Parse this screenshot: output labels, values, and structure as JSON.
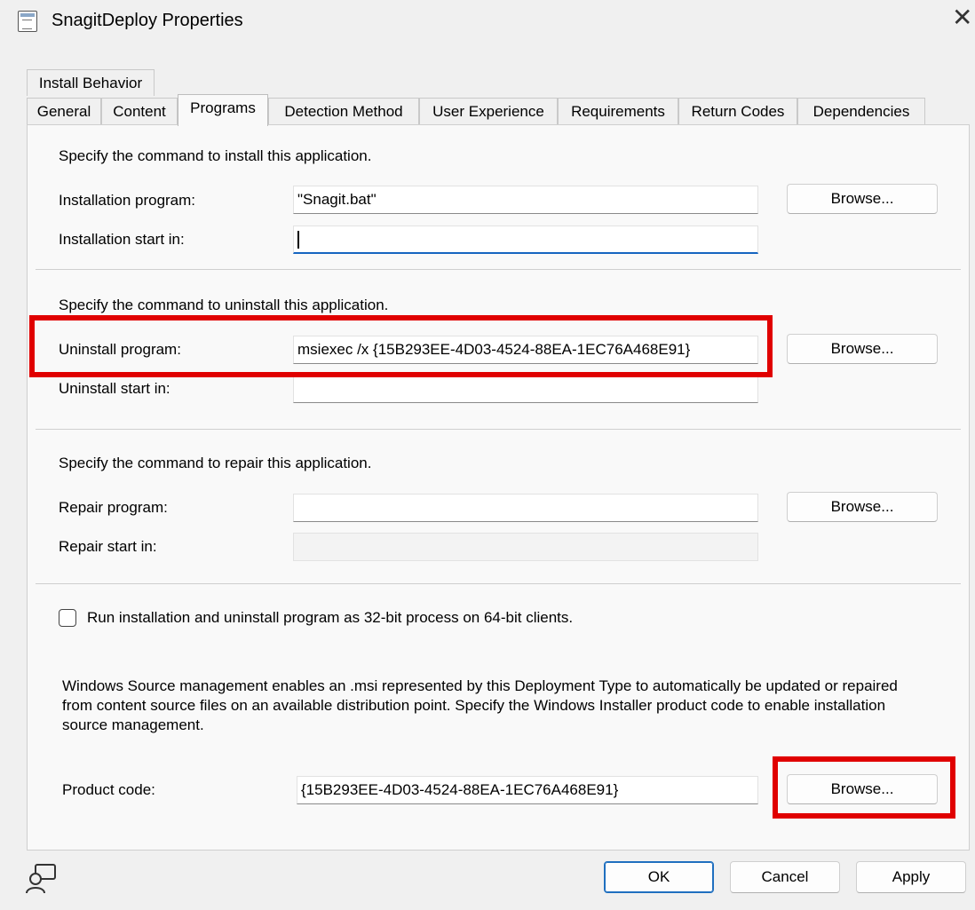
{
  "window": {
    "title": "SnagitDeploy Properties",
    "close_glyph": "✕"
  },
  "tabs": {
    "row1": [
      "Install Behavior"
    ],
    "row2": [
      "General",
      "Content",
      "Programs",
      "Detection Method",
      "User Experience",
      "Requirements",
      "Return Codes",
      "Dependencies"
    ],
    "active": "Programs"
  },
  "install": {
    "heading": "Specify the command to install this application.",
    "program_label": "Installation program:",
    "program_value": "\"Snagit.bat\"",
    "start_label": "Installation start in:",
    "start_value": "",
    "browse_label": "Browse..."
  },
  "uninstall": {
    "heading": "Specify the command to uninstall this application.",
    "program_label": "Uninstall program:",
    "program_value": "msiexec /x {15B293EE-4D03-4524-88EA-1EC76A468E91}",
    "start_label": "Uninstall start in:",
    "start_value": "",
    "browse_label": "Browse..."
  },
  "repair": {
    "heading": "Specify the command to repair this application.",
    "program_label": "Repair program:",
    "program_value": "",
    "start_label": "Repair start in:",
    "start_value": "",
    "browse_label": "Browse..."
  },
  "options": {
    "run_32bit_label": "Run installation and uninstall program as 32-bit process on 64-bit clients.",
    "run_32bit_checked": false
  },
  "source_management": {
    "description": "Windows Source management enables an .msi represented by this Deployment Type to automatically be updated or repaired from content source files on an available distribution point. Specify the Windows Installer product code to enable installation source management.",
    "product_code_label": "Product code:",
    "product_code_value": "{15B293EE-4D03-4524-88EA-1EC76A468E91}",
    "browse_label": "Browse..."
  },
  "footer": {
    "ok_label": "OK",
    "cancel_label": "Cancel",
    "apply_label": "Apply"
  },
  "colors": {
    "highlight": "#e00000",
    "focus": "#1565c0"
  }
}
